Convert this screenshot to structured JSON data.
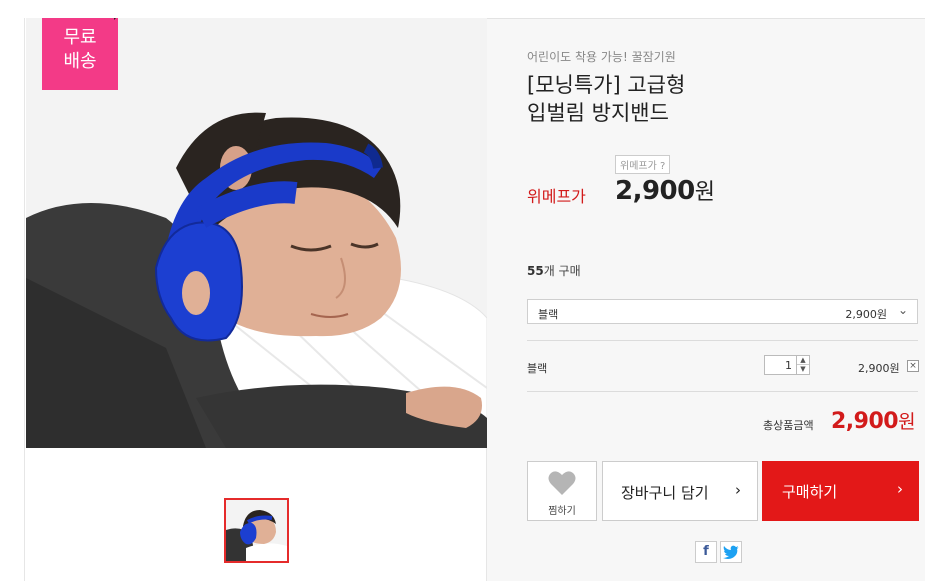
{
  "badge": {
    "line1": "무료",
    "line2": "배송"
  },
  "product": {
    "subtitle": "어린이도 착용 가능! 꿀잠기원",
    "title_line1": "[모닝특가] 고급형",
    "title_line2": "입벌림 방지밴드"
  },
  "price": {
    "help": "위메프가 ?",
    "label": "위메프가",
    "amount": "2,900",
    "currency": "원"
  },
  "sales": {
    "count": "55",
    "suffix": "개 구매"
  },
  "option_select": {
    "selected": "블랙",
    "price": "2,900원"
  },
  "line_item": {
    "name": "블랙",
    "quantity": "1",
    "price": "2,900원",
    "remove": "×"
  },
  "total": {
    "label": "총상품금액",
    "amount": "2,900",
    "currency": "원"
  },
  "buttons": {
    "wish": "찜하기",
    "cart": "장바구니 담기",
    "buy": "구매하기",
    "arrow": "›"
  },
  "social": {
    "facebook": "f",
    "twitter": "t"
  },
  "icons": [
    "heart-icon",
    "chevron-down-icon",
    "arrow-right-icon",
    "facebook-icon",
    "twitter-icon",
    "close-icon"
  ],
  "colors": {
    "accent_red": "#e31818",
    "price_red": "#d21b1b",
    "badge_pink": "#f33a87"
  }
}
